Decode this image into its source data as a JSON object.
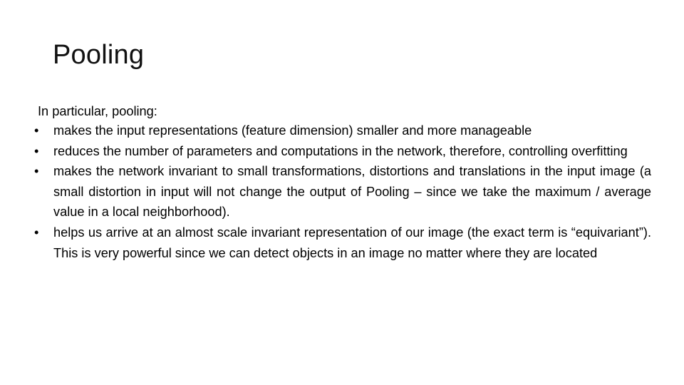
{
  "slide": {
    "title": "Pooling",
    "intro": "In particular, pooling:",
    "bullet_glyph": "•",
    "bullets": [
      "makes the input representations (feature dimension) smaller and more manageable",
      "reduces the number of parameters and computations in the network, therefore, controlling overfitting",
      "makes the network invariant to small transformations, distortions and translations in the input image (a small distortion in input will not change the output of Pooling – since we take the maximum / average value in a local neighborhood).",
      "helps us arrive at an almost scale invariant representation of our image (the exact term is “equivariant”). This is very powerful since we can detect objects in an image no matter where they are located"
    ]
  }
}
